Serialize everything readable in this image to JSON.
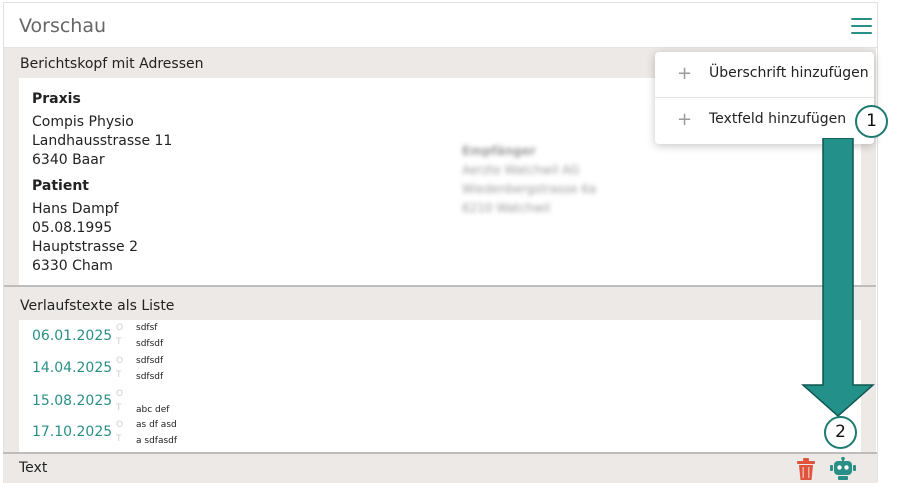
{
  "header": {
    "title": "Vorschau",
    "menu_icon": "hamburger-menu-icon"
  },
  "menu": {
    "items": [
      {
        "icon": "plus-icon",
        "label": "Überschrift hinzufügen"
      },
      {
        "icon": "plus-icon",
        "label": "Textfeld hinzufügen"
      }
    ]
  },
  "sections": {
    "address": {
      "title": "Berichtskopf mit Adressen",
      "praxis": {
        "heading": "Praxis",
        "lines": [
          "Compis Physio",
          "Landhausstrasse 11",
          "6340 Baar"
        ]
      },
      "patient": {
        "heading": "Patient",
        "lines": [
          "Hans Dampf",
          "05.08.1995",
          "Hauptstrasse 2",
          "6330 Cham"
        ]
      },
      "recipient": {
        "heading": "Empfänger",
        "lines": [
          "Aerzte Watchwil AG",
          "Wiedenbergstrasse 6a",
          "6210 Watchwil"
        ]
      }
    },
    "history": {
      "title": "Verlaufstexte als Liste",
      "rows": [
        {
          "date": "06.01.2025",
          "o": "O",
          "t": "T",
          "line1": "sdfsf",
          "line2": "sdfsdf"
        },
        {
          "date": "14.04.2025",
          "o": "O",
          "t": "T",
          "line1": "sdfsdf",
          "line2": "sdfsdf"
        },
        {
          "date": "15.08.2025",
          "o": "O",
          "t": "T",
          "line1": "",
          "line2": "abc def"
        },
        {
          "date": "17.10.2025",
          "o": "O",
          "t": "T",
          "line1": "as df asd",
          "line2": "a sdfasdf"
        }
      ]
    },
    "text": {
      "title": "Text",
      "icons": [
        "trash-icon",
        "robot-icon"
      ]
    }
  },
  "callouts": [
    "1",
    "2"
  ],
  "colors": {
    "accent": "#2a8f86",
    "danger": "#e0533d",
    "arrow": "#23918a",
    "section_bg": "#ece9e6"
  }
}
